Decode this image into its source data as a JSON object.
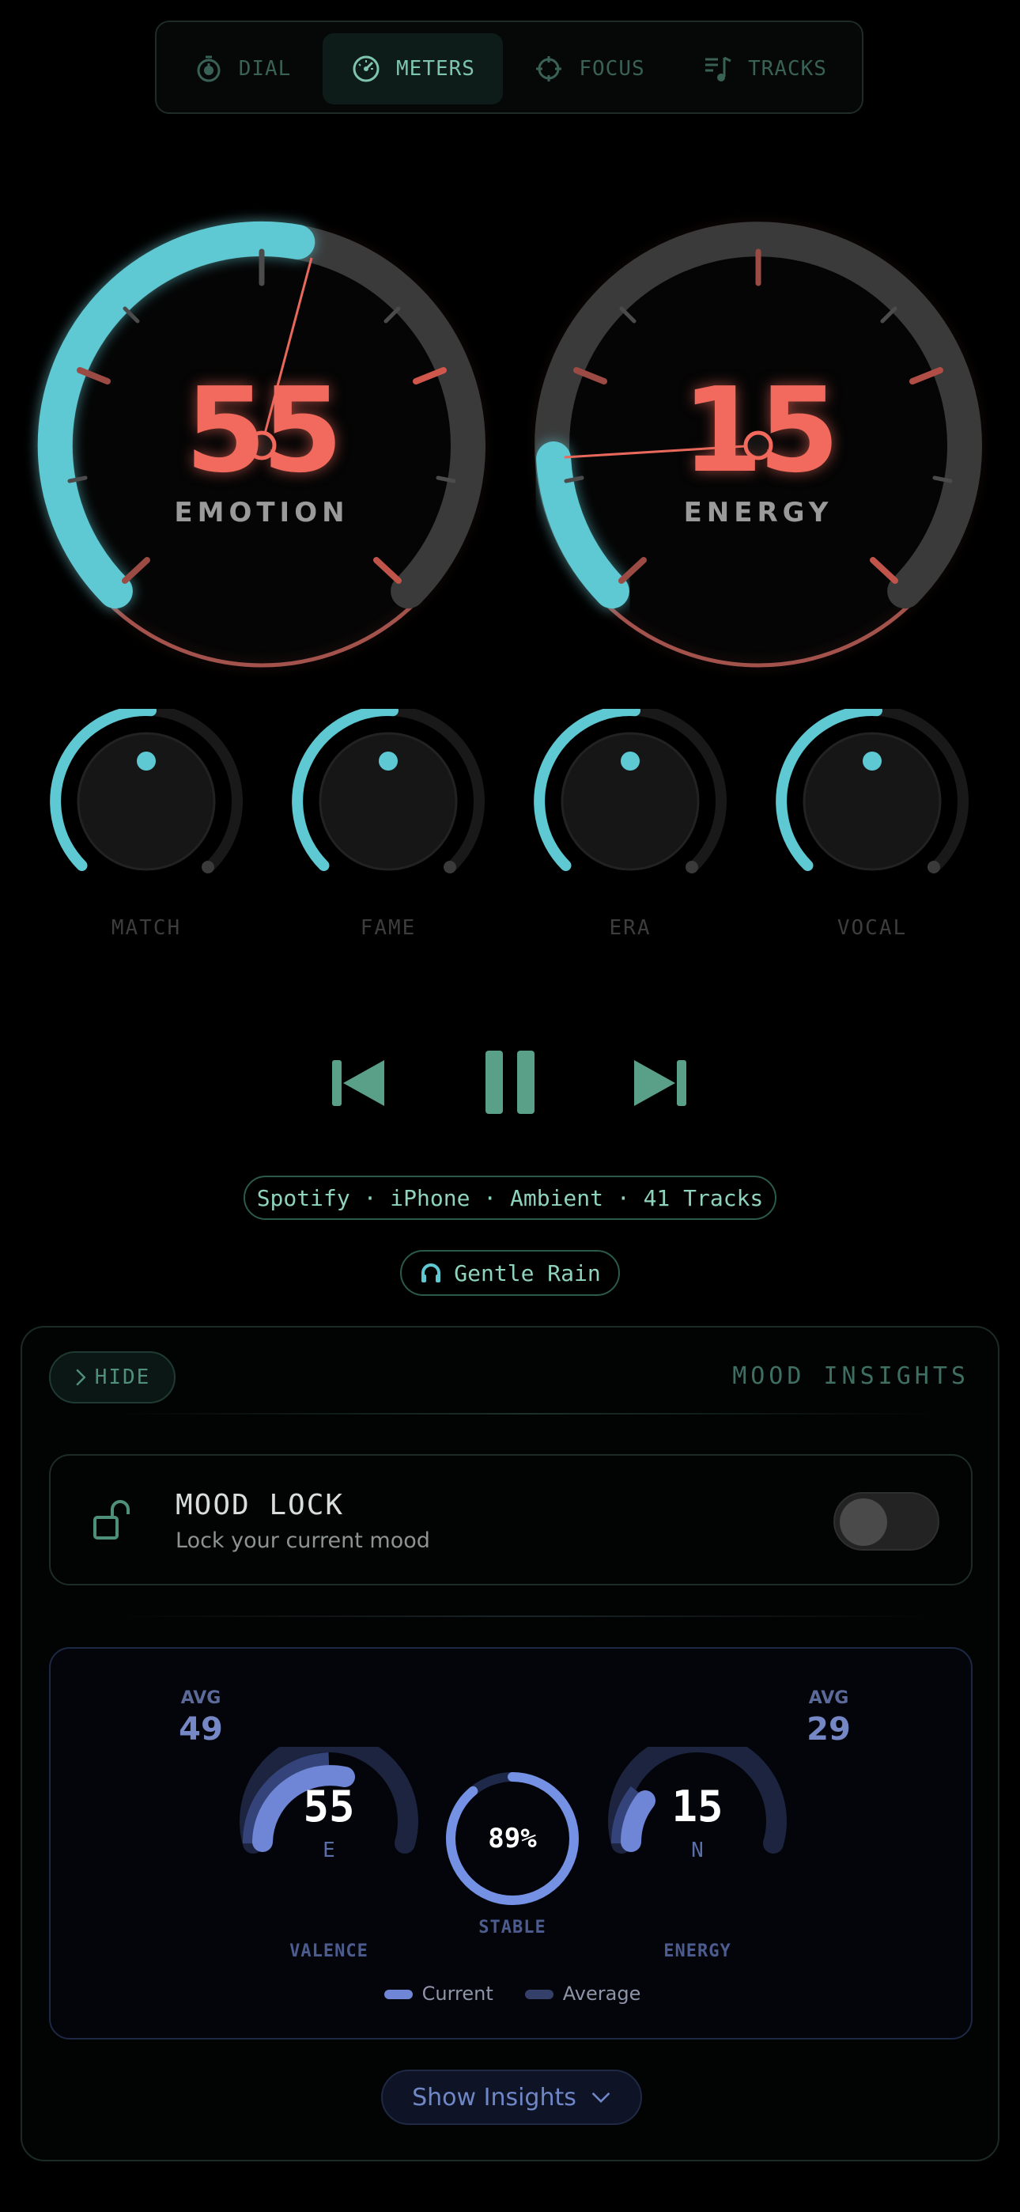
{
  "tabs": [
    {
      "label": "DIAL",
      "icon": "timer-icon",
      "active": false
    },
    {
      "label": "METERS",
      "icon": "speedometer-icon",
      "active": true
    },
    {
      "label": "FOCUS",
      "icon": "crosshair-icon",
      "active": false
    },
    {
      "label": "TRACKS",
      "icon": "playlist-icon",
      "active": false
    }
  ],
  "gauges": [
    {
      "value": "55",
      "label": "EMOTION",
      "fill_fraction": 0.55
    },
    {
      "value": "15",
      "label": "ENERGY",
      "fill_fraction": 0.15
    }
  ],
  "knobs": [
    {
      "label": "MATCH"
    },
    {
      "label": "FAME"
    },
    {
      "label": "ERA"
    },
    {
      "label": "VOCAL"
    }
  ],
  "source_info": "Spotify · iPhone · Ambient · 41 Tracks",
  "now_playing": "Gentle Rain",
  "panel": {
    "hide_label": "HIDE",
    "title": "MOOD INSIGHTS",
    "mood_lock": {
      "title": "MOOD LOCK",
      "subtitle": "Lock your current mood",
      "enabled": false
    },
    "mood": {
      "avg_left_label": "AVG",
      "avg_left_value": "49",
      "avg_right_label": "AVG",
      "avg_right_value": "29",
      "valence": {
        "value": "55",
        "sub": "E",
        "label": "VALENCE"
      },
      "stability": {
        "value": "89%",
        "label": "STABLE",
        "fraction": 0.89
      },
      "energy": {
        "value": "15",
        "sub": "N",
        "label": "ENERGY"
      },
      "legend": {
        "current": "Current",
        "average": "Average"
      }
    },
    "show_insights": "Show Insights"
  },
  "colors": {
    "accent_teal": "#5ec9d3",
    "accent_red": "#f26a5e",
    "accent_blue": "#6f86d6"
  }
}
